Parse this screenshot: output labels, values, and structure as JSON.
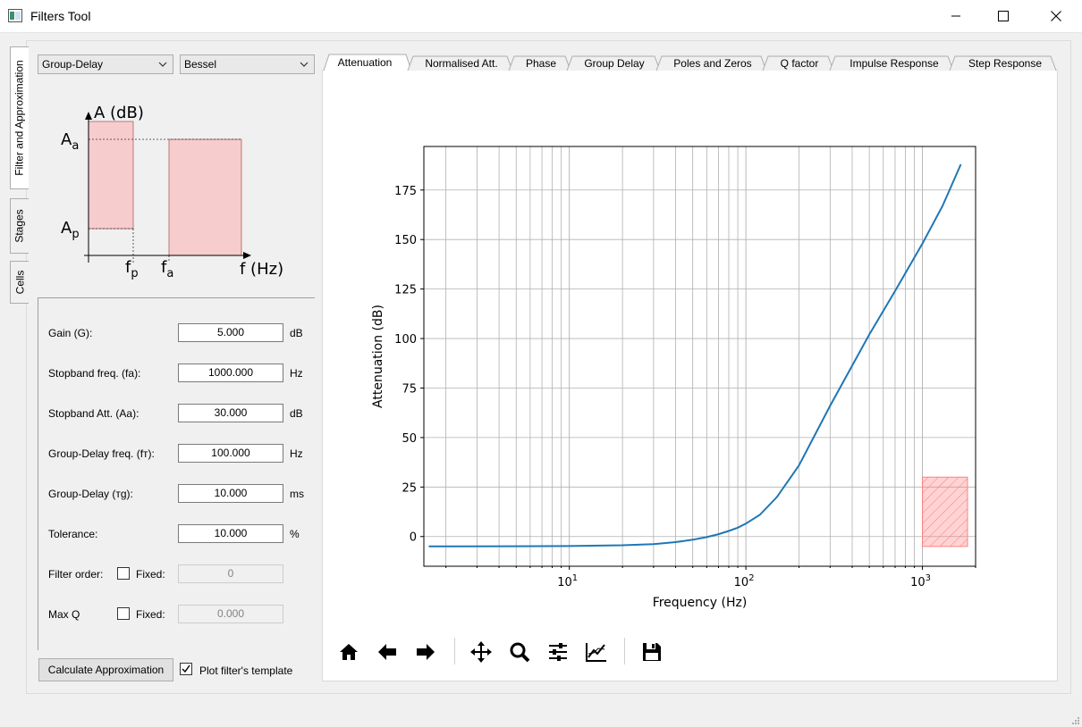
{
  "window": {
    "title": "Filters Tool",
    "icon": "window-app-icon",
    "controls": [
      "minimize-icon",
      "maximize-icon",
      "close-icon"
    ]
  },
  "side_tabs": [
    {
      "label": "Filter and Approximation",
      "active": true
    },
    {
      "label": "Stages",
      "active": false
    },
    {
      "label": "Cells",
      "active": false
    }
  ],
  "selectors": {
    "filter_type": "Group-Delay",
    "approximation": "Bessel"
  },
  "template_diagram": {
    "y_axis_label": "A (dB)",
    "x_axis_label": "f (Hz)",
    "level_a": "A",
    "level_a_sub": "a",
    "level_p": "A",
    "level_p_sub": "p",
    "freq_p": "f",
    "freq_p_sub": "p",
    "freq_a": "f",
    "freq_a_sub": "a"
  },
  "form": {
    "gain": {
      "label": "Gain (G):",
      "value": "5.000",
      "unit": "dB"
    },
    "stopband_freq": {
      "label": "Stopband freq. (fa):",
      "value": "1000.000",
      "unit": "Hz"
    },
    "stopband_att": {
      "label": "Stopband Att. (Aa):",
      "value": "30.000",
      "unit": "dB"
    },
    "gd_freq": {
      "label": "Group-Delay freq. (fт):",
      "value": "100.000",
      "unit": "Hz"
    },
    "gd": {
      "label": "Group-Delay (тg):",
      "value": "10.000",
      "unit": "ms"
    },
    "tolerance": {
      "label": "Tolerance:",
      "value": "10.000",
      "unit": "%"
    },
    "filter_order": {
      "label": "Filter order:",
      "fixed_label": "Fixed:",
      "fixed": false,
      "value": "0"
    },
    "max_q": {
      "label": "Max Q",
      "fixed_label": "Fixed:",
      "fixed": false,
      "value": "0.000"
    }
  },
  "actions": {
    "calculate_label": "Calculate Approximation",
    "plot_template_label": "Plot filter's template",
    "plot_template_checked": true
  },
  "plot_tabs": [
    "Attenuation",
    "Normalised Att.",
    "Phase",
    "Group Delay",
    "Poles and Zeros",
    "Q factor",
    "Impulse Response",
    "Step Response"
  ],
  "active_plot_tab": "Attenuation",
  "toolbar": [
    "home-icon",
    "back-icon",
    "forward-icon",
    "pan-icon",
    "zoom-icon",
    "configure-subplots-icon",
    "edit-axis-icon",
    "save-icon"
  ],
  "chart_data": {
    "type": "line",
    "title": "",
    "xlabel": "Frequency (Hz)",
    "ylabel": "Attenuation (dB)",
    "xscale": "log",
    "xlim": [
      1.5,
      2000
    ],
    "ylim": [
      -15,
      197
    ],
    "x_ticks": [
      10,
      100,
      1000
    ],
    "x_tick_labels": [
      {
        "base": "10",
        "exp": "1"
      },
      {
        "base": "10",
        "exp": "2"
      },
      {
        "base": "10",
        "exp": "3"
      }
    ],
    "y_ticks": [
      0,
      25,
      50,
      75,
      100,
      125,
      150,
      175
    ],
    "grid": true,
    "series": [
      {
        "color": "#1f77b4",
        "x": [
          1.6,
          5,
          10,
          20,
          30,
          40,
          50,
          60,
          70,
          80,
          90,
          100,
          120,
          150,
          200,
          300,
          500,
          700,
          1000,
          1300,
          1650
        ],
        "y": [
          -5,
          -4.9,
          -4.8,
          -4.4,
          -3.8,
          -2.8,
          -1.6,
          -0.3,
          1.2,
          2.8,
          4.5,
          6.5,
          11,
          20,
          36,
          66,
          102,
          124,
          148,
          167,
          188
        ]
      }
    ],
    "template_region": {
      "x": [
        1000,
        1800
      ],
      "y": [
        -5,
        30
      ],
      "color": "#ff8080",
      "hatch": "//"
    }
  }
}
